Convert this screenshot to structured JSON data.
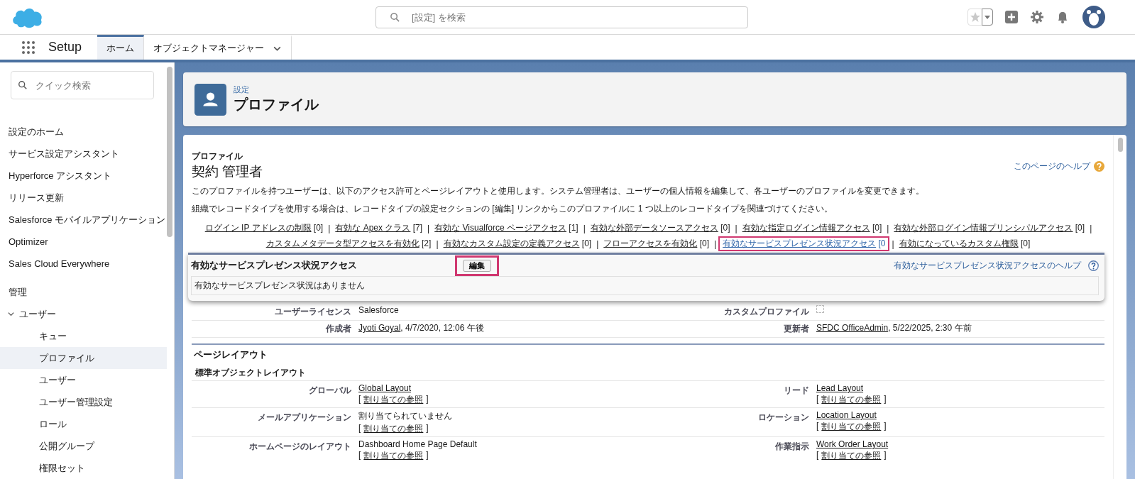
{
  "header": {
    "search_placeholder": "[設定] を検索"
  },
  "nav": {
    "app_name": "Setup",
    "tabs": [
      {
        "label": "ホーム",
        "selected": true,
        "has_menu": false
      },
      {
        "label": "オブジェクトマネージャー",
        "selected": false,
        "has_menu": true
      }
    ]
  },
  "sidebar": {
    "search_placeholder": "クイック検索",
    "items": [
      {
        "label": "設定のホーム",
        "selected": false
      },
      {
        "label": "サービス設定アシスタント",
        "selected": false
      },
      {
        "label": "Hyperforce アシスタント",
        "selected": false
      },
      {
        "label": "リリース更新",
        "selected": false
      },
      {
        "label": "Salesforce モバイルアプリケーション",
        "selected": false
      },
      {
        "label": "Optimizer",
        "selected": false
      },
      {
        "label": "Sales Cloud Everywhere",
        "selected": false
      }
    ],
    "section": "管理",
    "groups": [
      {
        "label": "ユーザー",
        "expanded": true,
        "children": [
          {
            "label": "キュー",
            "selected": false
          },
          {
            "label": "プロファイル",
            "selected": true
          },
          {
            "label": "ユーザー",
            "selected": false
          },
          {
            "label": "ユーザー管理設定",
            "selected": false
          },
          {
            "label": "ロール",
            "selected": false
          },
          {
            "label": "公開グループ",
            "selected": false
          },
          {
            "label": "権限セット",
            "selected": false
          }
        ]
      }
    ]
  },
  "page_header": {
    "breadcrumb": "設定",
    "title": "プロファイル"
  },
  "profile": {
    "type_label": "プロファイル",
    "name": "契約 管理者",
    "help_link": "このページのヘルプ",
    "paragraphs": [
      "このプロファイルを持つユーザーは、以下のアクセス許可とページレイアウトと使用します。システム管理者は、ユーザーの個人情報を編集して、各ユーザーのプロファイルを変更できます。",
      "組織でレコードタイプを使用する場合は、レコードタイプの設定セクションの [編集] リンクからこのプロファイルに 1 つ以上のレコードタイプを関連づけてください。"
    ],
    "related_links": [
      [
        {
          "label": "ログイン IP アドレスの制限",
          "count": "[0]",
          "separator": "|",
          "highlighted": false
        },
        {
          "label": "有効な Apex クラス",
          "count": "[7]",
          "separator": "|",
          "highlighted": false
        },
        {
          "label": "有効な Visualforce ページアクセス",
          "count": "[1]",
          "separator": "|",
          "highlighted": false
        },
        {
          "label": "有効な外部データソースアクセス",
          "count": "[0]",
          "separator": "|",
          "highlighted": false
        },
        {
          "label": "有効な指定ログイン情報アクセス",
          "count": "[0]",
          "separator": "|",
          "highlighted": false
        },
        {
          "label": "有効な外部ログイン情報プリンシパルアクセス",
          "count": "[0]",
          "separator": "|",
          "highlighted": false
        }
      ],
      [
        {
          "label": "カスタムメタデータ型アクセスを有効化",
          "count": "[2]",
          "separator": "|",
          "highlighted": false
        },
        {
          "label": "有効なカスタム設定の定義アクセス",
          "count": "[0]",
          "separator": "|",
          "highlighted": false
        },
        {
          "label": "フローアクセスを有効化",
          "count": "[0]",
          "separator": "|",
          "highlighted": false
        },
        {
          "label": "有効なサービスプレゼンス状況アクセス",
          "count": "[0",
          "separator": "|",
          "highlighted": true
        },
        {
          "label": "有効になっているカスタム権限",
          "count": "[0]",
          "highlighted": false
        }
      ]
    ],
    "section": {
      "title": "有効なサービスプレゼンス状況アクセス",
      "edit_button": {
        "label": "編集",
        "highlighted": true
      },
      "help_link": "有効なサービスプレゼンス状況アクセスのヘルプ",
      "empty_text": "有効なサービスプレゼンス状況はありません"
    },
    "details": [
      {
        "left": {
          "label": "ユーザーライセンス",
          "kind": "text",
          "text": "Salesforce"
        },
        "right": {
          "label": "カスタムプロファイル",
          "kind": "checkbox",
          "checked": false
        }
      },
      {
        "left": {
          "label": "作成者",
          "kind": "user",
          "link": "Jyoti Goyal",
          "text": ", 4/7/2020, 12:06 午後"
        },
        "right": {
          "label": "更新者",
          "kind": "user",
          "link": "SFDC OfficeAdmin",
          "text": ", 5/22/2025, 2:30 午前"
        }
      }
    ],
    "page_layouts": {
      "title": "ページレイアウト",
      "subsection": "標準オブジェクトレイアウト",
      "rows": [
        {
          "left": {
            "label": "グローバル",
            "kind": "link",
            "value": "Global Layout",
            "assign": {
              "open": "[",
              "link": "割り当ての参照",
              "close": "]"
            }
          },
          "right": {
            "label": "リード",
            "kind": "link",
            "value": "Lead Layout",
            "assign": {
              "open": "[",
              "link": "割り当ての参照",
              "close": "]"
            }
          }
        },
        {
          "left": {
            "label": "メールアプリケーション",
            "kind": "text",
            "value": "割り当てられていません",
            "assign": {
              "open": "[",
              "link": "割り当ての参照",
              "close": "]"
            }
          },
          "right": {
            "label": "ロケーション",
            "kind": "link",
            "value": "Location Layout",
            "assign": {
              "open": "[",
              "link": "割り当ての参照",
              "close": "]"
            }
          }
        },
        {
          "left": {
            "label": "ホームページのレイアウト",
            "kind": "text",
            "value": "Dashboard Home Page Default",
            "assign": {
              "open": "[",
              "link": "割り当ての参照",
              "close": "]"
            }
          },
          "right": {
            "label": "作業指示",
            "kind": "link",
            "value": "Work Order Layout",
            "assign": {
              "open": "[",
              "link": "割り当ての参照",
              "close": "]"
            }
          }
        }
      ]
    }
  }
}
